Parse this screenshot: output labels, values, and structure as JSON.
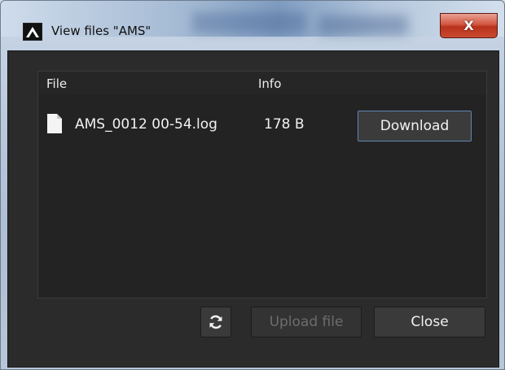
{
  "window": {
    "title": "View files \"AMS\"",
    "app_icon": "app-logo-icon",
    "close_glyph": "X"
  },
  "file_list": {
    "columns": [
      "File",
      "Info"
    ],
    "rows": [
      {
        "icon": "file-icon",
        "name": "AMS_0012 00-54.log",
        "info": "178 B",
        "action_label": "Download"
      }
    ]
  },
  "footer": {
    "refresh_icon": "refresh-icon",
    "upload_label": "Upload file",
    "close_label": "Close"
  },
  "colors": {
    "dialog_bg": "#2b2b2b",
    "list_bg": "#232323",
    "accent_border": "#5f87b3",
    "close_button_red": "#c94a30"
  }
}
